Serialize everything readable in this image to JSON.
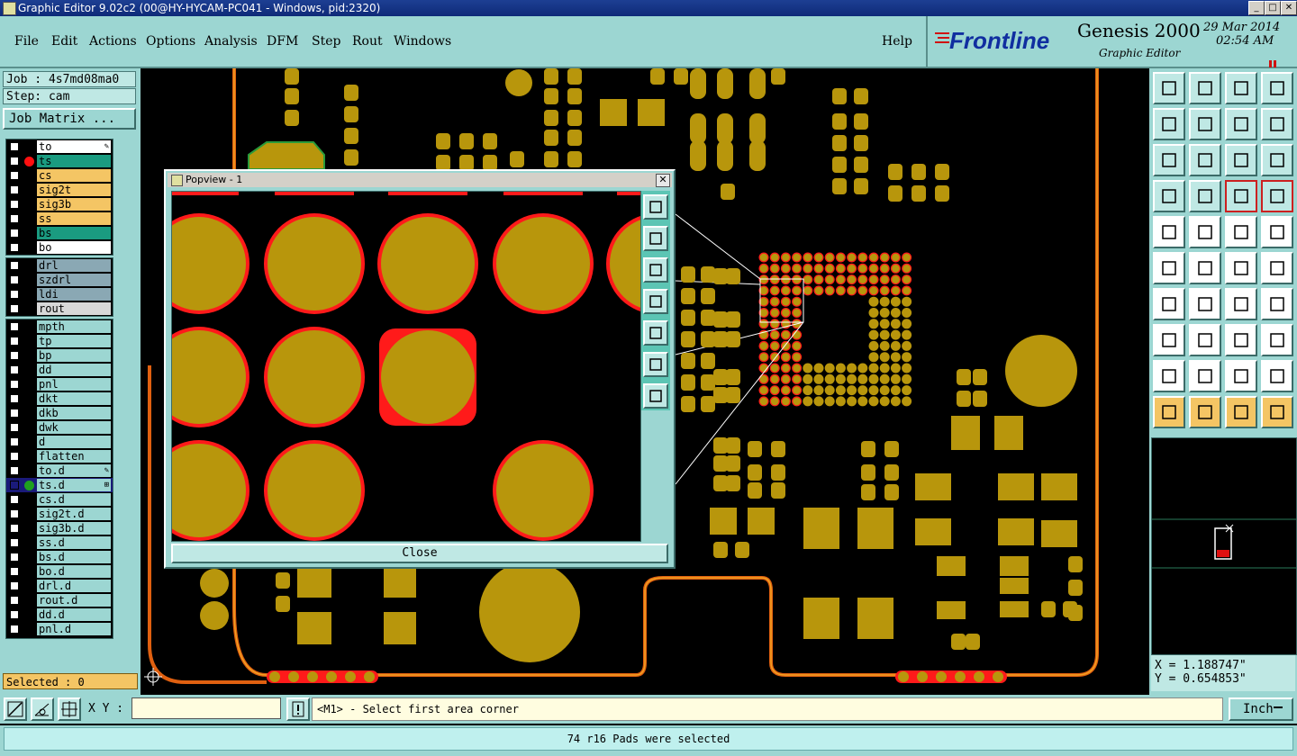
{
  "window": {
    "title": "Graphic Editor 9.02c2 (00@HY-HYCAM-PC041 - Windows, pid:2320)"
  },
  "menu": [
    "File",
    "Edit",
    "Actions",
    "Options",
    "Analysis",
    "DFM",
    "Step",
    "Rout",
    "Windows"
  ],
  "help": "Help",
  "brand": {
    "logo": "Frontline",
    "product": "Genesis 2000",
    "subtitle": "Graphic Editor",
    "date": "29 Mar 2014",
    "time": "02:54 AM"
  },
  "job": "Job : 4s7md08ma0",
  "step": "Step: cam",
  "job_matrix": "Job Matrix ...",
  "layers_board": [
    {
      "name": "to",
      "color": "#ffffff",
      "mark": "✎"
    },
    {
      "name": "ts",
      "color": "#1a9b80",
      "dot": "#ff1010"
    },
    {
      "name": "cs",
      "color": "#f4c564"
    },
    {
      "name": "sig2t",
      "color": "#f4c564"
    },
    {
      "name": "sig3b",
      "color": "#f4c564"
    },
    {
      "name": "ss",
      "color": "#f4c564"
    },
    {
      "name": "bs",
      "color": "#1a9b80"
    },
    {
      "name": "bo",
      "color": "#ffffff"
    }
  ],
  "layers_drill": [
    {
      "name": "drl",
      "color": "#8aa8b4"
    },
    {
      "name": "szdrl",
      "color": "#8aa8b4"
    },
    {
      "name": "ldi",
      "color": "#8aa8b4"
    },
    {
      "name": "rout",
      "color": "#d8d8d8"
    }
  ],
  "layers_misc": [
    {
      "name": "mpth"
    },
    {
      "name": "tp"
    },
    {
      "name": "bp"
    },
    {
      "name": "dd"
    },
    {
      "name": "pnl"
    },
    {
      "name": "dkt"
    },
    {
      "name": "dkb"
    },
    {
      "name": "dwk"
    },
    {
      "name": "d"
    },
    {
      "name": "flatten"
    },
    {
      "name": "to.d",
      "mark": "✎"
    },
    {
      "name": "ts.d",
      "dot": "#1fa01f",
      "mark": "⊞",
      "active": true
    },
    {
      "name": "cs.d"
    },
    {
      "name": "sig2t.d"
    },
    {
      "name": "sig3b.d"
    },
    {
      "name": "ss.d"
    },
    {
      "name": "bs.d"
    },
    {
      "name": "bo.d"
    },
    {
      "name": "drl.d"
    },
    {
      "name": "rout.d"
    },
    {
      "name": "dd.d"
    },
    {
      "name": "pnl.d"
    }
  ],
  "selected": "Selected : 0",
  "popview": {
    "title": "Popview - 1",
    "close": "Close"
  },
  "coords": {
    "x": "X = 1.188747\"",
    "y": "Y = 0.654853\""
  },
  "xy_label": "X Y :",
  "xy_value": "",
  "prompt": "<M1> - Select first area corner",
  "units": "Inch",
  "status": "74 r16 Pads were selected",
  "colors": {
    "pad": "#b8960c",
    "highlight": "#ff1a1a",
    "panel": "#9cd6d2",
    "trace": "#e06010"
  }
}
